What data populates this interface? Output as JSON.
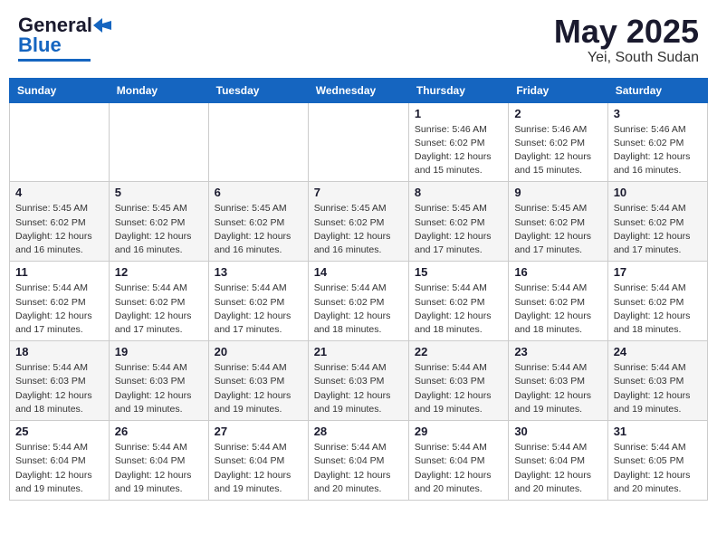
{
  "header": {
    "logo_general": "General",
    "logo_blue": "Blue",
    "month": "May 2025",
    "location": "Yei, South Sudan"
  },
  "columns": [
    "Sunday",
    "Monday",
    "Tuesday",
    "Wednesday",
    "Thursday",
    "Friday",
    "Saturday"
  ],
  "weeks": [
    [
      {
        "day": "",
        "info": ""
      },
      {
        "day": "",
        "info": ""
      },
      {
        "day": "",
        "info": ""
      },
      {
        "day": "",
        "info": ""
      },
      {
        "day": "1",
        "info": "Sunrise: 5:46 AM\nSunset: 6:02 PM\nDaylight: 12 hours\nand 15 minutes."
      },
      {
        "day": "2",
        "info": "Sunrise: 5:46 AM\nSunset: 6:02 PM\nDaylight: 12 hours\nand 15 minutes."
      },
      {
        "day": "3",
        "info": "Sunrise: 5:46 AM\nSunset: 6:02 PM\nDaylight: 12 hours\nand 16 minutes."
      }
    ],
    [
      {
        "day": "4",
        "info": "Sunrise: 5:45 AM\nSunset: 6:02 PM\nDaylight: 12 hours\nand 16 minutes."
      },
      {
        "day": "5",
        "info": "Sunrise: 5:45 AM\nSunset: 6:02 PM\nDaylight: 12 hours\nand 16 minutes."
      },
      {
        "day": "6",
        "info": "Sunrise: 5:45 AM\nSunset: 6:02 PM\nDaylight: 12 hours\nand 16 minutes."
      },
      {
        "day": "7",
        "info": "Sunrise: 5:45 AM\nSunset: 6:02 PM\nDaylight: 12 hours\nand 16 minutes."
      },
      {
        "day": "8",
        "info": "Sunrise: 5:45 AM\nSunset: 6:02 PM\nDaylight: 12 hours\nand 17 minutes."
      },
      {
        "day": "9",
        "info": "Sunrise: 5:45 AM\nSunset: 6:02 PM\nDaylight: 12 hours\nand 17 minutes."
      },
      {
        "day": "10",
        "info": "Sunrise: 5:44 AM\nSunset: 6:02 PM\nDaylight: 12 hours\nand 17 minutes."
      }
    ],
    [
      {
        "day": "11",
        "info": "Sunrise: 5:44 AM\nSunset: 6:02 PM\nDaylight: 12 hours\nand 17 minutes."
      },
      {
        "day": "12",
        "info": "Sunrise: 5:44 AM\nSunset: 6:02 PM\nDaylight: 12 hours\nand 17 minutes."
      },
      {
        "day": "13",
        "info": "Sunrise: 5:44 AM\nSunset: 6:02 PM\nDaylight: 12 hours\nand 17 minutes."
      },
      {
        "day": "14",
        "info": "Sunrise: 5:44 AM\nSunset: 6:02 PM\nDaylight: 12 hours\nand 18 minutes."
      },
      {
        "day": "15",
        "info": "Sunrise: 5:44 AM\nSunset: 6:02 PM\nDaylight: 12 hours\nand 18 minutes."
      },
      {
        "day": "16",
        "info": "Sunrise: 5:44 AM\nSunset: 6:02 PM\nDaylight: 12 hours\nand 18 minutes."
      },
      {
        "day": "17",
        "info": "Sunrise: 5:44 AM\nSunset: 6:02 PM\nDaylight: 12 hours\nand 18 minutes."
      }
    ],
    [
      {
        "day": "18",
        "info": "Sunrise: 5:44 AM\nSunset: 6:03 PM\nDaylight: 12 hours\nand 18 minutes."
      },
      {
        "day": "19",
        "info": "Sunrise: 5:44 AM\nSunset: 6:03 PM\nDaylight: 12 hours\nand 19 minutes."
      },
      {
        "day": "20",
        "info": "Sunrise: 5:44 AM\nSunset: 6:03 PM\nDaylight: 12 hours\nand 19 minutes."
      },
      {
        "day": "21",
        "info": "Sunrise: 5:44 AM\nSunset: 6:03 PM\nDaylight: 12 hours\nand 19 minutes."
      },
      {
        "day": "22",
        "info": "Sunrise: 5:44 AM\nSunset: 6:03 PM\nDaylight: 12 hours\nand 19 minutes."
      },
      {
        "day": "23",
        "info": "Sunrise: 5:44 AM\nSunset: 6:03 PM\nDaylight: 12 hours\nand 19 minutes."
      },
      {
        "day": "24",
        "info": "Sunrise: 5:44 AM\nSunset: 6:03 PM\nDaylight: 12 hours\nand 19 minutes."
      }
    ],
    [
      {
        "day": "25",
        "info": "Sunrise: 5:44 AM\nSunset: 6:04 PM\nDaylight: 12 hours\nand 19 minutes."
      },
      {
        "day": "26",
        "info": "Sunrise: 5:44 AM\nSunset: 6:04 PM\nDaylight: 12 hours\nand 19 minutes."
      },
      {
        "day": "27",
        "info": "Sunrise: 5:44 AM\nSunset: 6:04 PM\nDaylight: 12 hours\nand 19 minutes."
      },
      {
        "day": "28",
        "info": "Sunrise: 5:44 AM\nSunset: 6:04 PM\nDaylight: 12 hours\nand 20 minutes."
      },
      {
        "day": "29",
        "info": "Sunrise: 5:44 AM\nSunset: 6:04 PM\nDaylight: 12 hours\nand 20 minutes."
      },
      {
        "day": "30",
        "info": "Sunrise: 5:44 AM\nSunset: 6:04 PM\nDaylight: 12 hours\nand 20 minutes."
      },
      {
        "day": "31",
        "info": "Sunrise: 5:44 AM\nSunset: 6:05 PM\nDaylight: 12 hours\nand 20 minutes."
      }
    ]
  ]
}
